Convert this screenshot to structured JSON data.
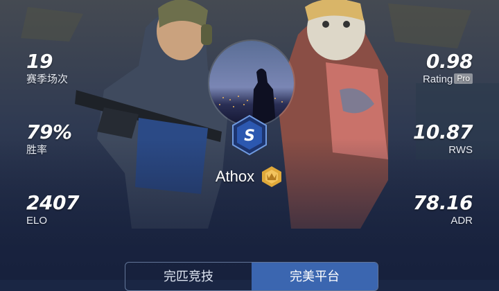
{
  "stats_left": [
    {
      "value": "19",
      "label": "赛季场次"
    },
    {
      "value": "79%",
      "label": "胜率"
    },
    {
      "value": "2407",
      "label": "ELO"
    }
  ],
  "stats_right": [
    {
      "value": "0.98",
      "label": "Rating",
      "badge": "Pro"
    },
    {
      "value": "10.87",
      "label": "RWS"
    },
    {
      "value": "78.16",
      "label": "ADR"
    }
  ],
  "player": {
    "name": "Athox",
    "rank_letter": "S"
  },
  "tabs": [
    {
      "label": "完匹竞技",
      "active": false
    },
    {
      "label": "完美平台",
      "active": true
    }
  ],
  "icons": {
    "rank": "rank-s-hexagon-icon",
    "crown": "crown-shield-icon"
  },
  "colors": {
    "background": "#1a2644",
    "accent_blue": "#3b66b0",
    "rank_gold": "#e0a93a"
  }
}
